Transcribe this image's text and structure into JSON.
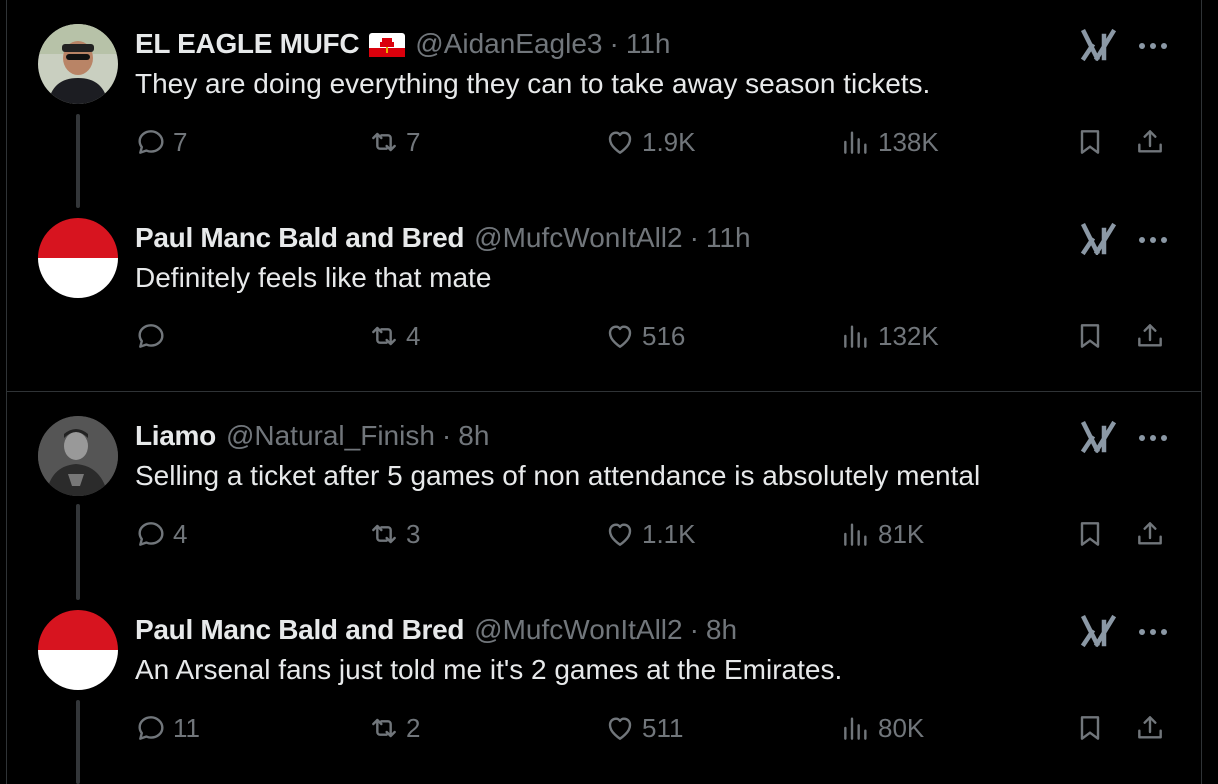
{
  "colors": {
    "background": "#000000",
    "text": "#e7e9ea",
    "muted": "#71767b",
    "border": "#2f3336",
    "thread_line": "#333639"
  },
  "tweets": [
    {
      "name": "EL EAGLE MUFC",
      "flag_icon": "gibraltar-flag-icon",
      "handle": "@AidanEagle3",
      "dot": "·",
      "time": "11h",
      "text": "They are doing everything they can to take away season tickets.",
      "replies": "7",
      "reposts": "7",
      "likes": "1.9K",
      "views": "138K"
    },
    {
      "name": "Paul Manc Bald and Bred",
      "handle": "@MufcWonItAll2",
      "dot": "·",
      "time": "11h",
      "text": "Definitely feels like that mate",
      "replies": "",
      "reposts": "4",
      "likes": "516",
      "views": "132K"
    },
    {
      "name": "Liamo",
      "handle": "@Natural_Finish",
      "dot": "·",
      "time": "8h",
      "text": "Selling a ticket after 5 games of non attendance is absolutely mental",
      "replies": "4",
      "reposts": "3",
      "likes": "1.1K",
      "views": "81K"
    },
    {
      "name": "Paul Manc Bald and Bred",
      "handle": "@MufcWonItAll2",
      "dot": "·",
      "time": "8h",
      "text": "An Arsenal fans just told me it's 2 games at the Emirates.",
      "replies": "11",
      "reposts": "2",
      "likes": "511",
      "views": "80K"
    }
  ]
}
